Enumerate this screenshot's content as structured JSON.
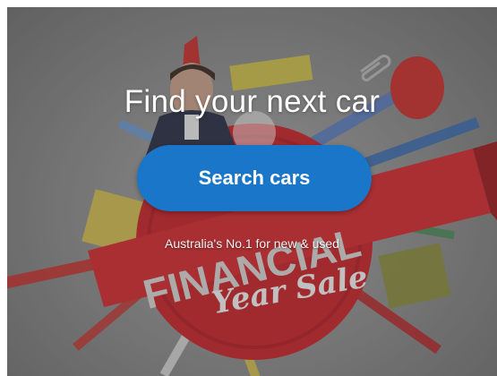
{
  "hero": {
    "headline": "Find your next car",
    "cta_label": "Search cars",
    "tagline": "Australia's No.1 for new & used"
  },
  "background_art": {
    "banner_word": "FINANCIAL",
    "script_text": "Year Sale"
  },
  "colors": {
    "cta": "#1976c9",
    "medallion": "#c8232a",
    "banner": "#d42a2f"
  }
}
